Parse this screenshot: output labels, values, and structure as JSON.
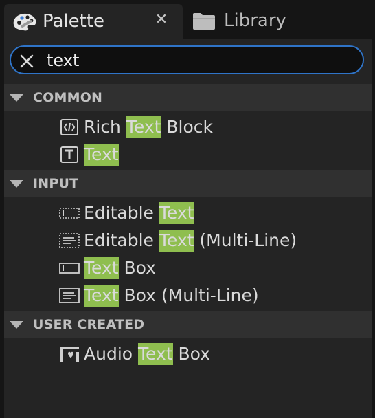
{
  "tabs": {
    "palette_label": "Palette",
    "close_glyph": "✕",
    "library_label": "Library"
  },
  "search": {
    "value": "text",
    "clear_icon": "close-icon"
  },
  "colors": {
    "highlight": "#8fbe4f",
    "focus_border": "#2f74c8",
    "panel_bg": "#242424",
    "category_bg": "#303030"
  },
  "categories": [
    {
      "name": "COMMON",
      "items": [
        {
          "pre": "Rich ",
          "match": "Text",
          "post": " Block",
          "icon": "rich-text-icon"
        },
        {
          "pre": "",
          "match": "Text",
          "post": "",
          "icon": "text-icon"
        }
      ]
    },
    {
      "name": "INPUT",
      "items": [
        {
          "pre": "Editable ",
          "match": "Text",
          "post": "",
          "icon": "editable-text-icon"
        },
        {
          "pre": "Editable ",
          "match": "Text",
          "post": " (Multi-Line)",
          "icon": "editable-text-multiline-icon"
        },
        {
          "pre": "",
          "match": "Text",
          "post": " Box",
          "icon": "text-box-icon"
        },
        {
          "pre": "",
          "match": "Text",
          "post": " Box (Multi-Line)",
          "icon": "text-box-multiline-icon"
        }
      ]
    },
    {
      "name": "USER CREATED",
      "items": [
        {
          "pre": "Audio ",
          "match": "Text",
          "post": " Box",
          "icon": "audio-text-box-icon"
        }
      ]
    }
  ]
}
